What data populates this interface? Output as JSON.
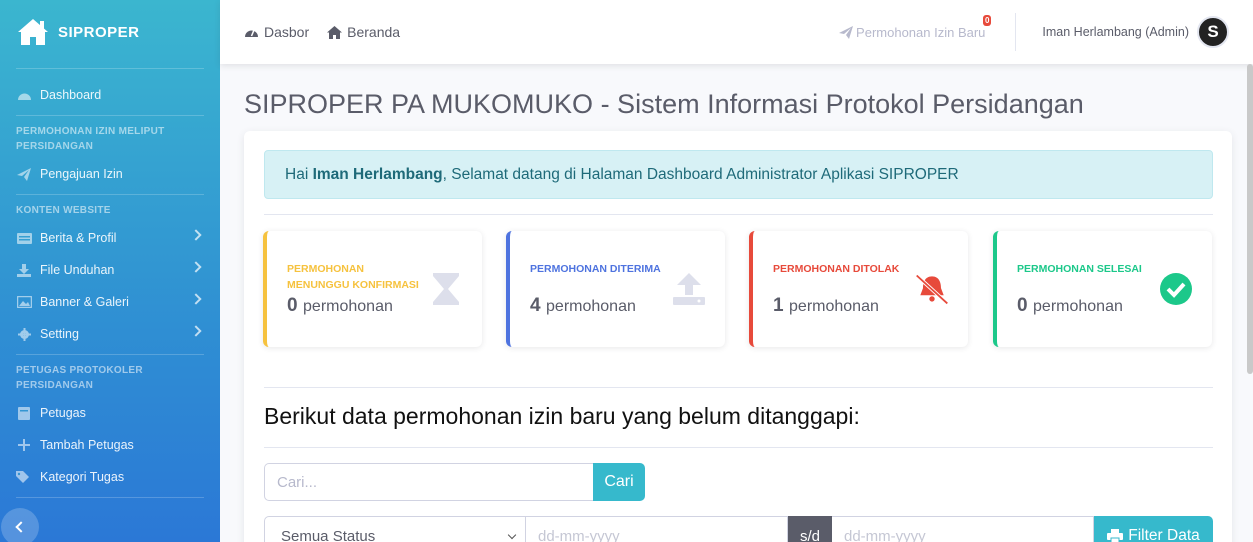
{
  "sidebar": {
    "brand": "SIPROPER",
    "items": [
      {
        "label": "Dashboard"
      },
      {
        "heading": "PERMOHONAN IZIN MELIPUT PERSIDANGAN"
      },
      {
        "label": "Pengajuan Izin"
      },
      {
        "heading": "KONTEN WEBSITE"
      },
      {
        "label": "Berita & Profil"
      },
      {
        "label": "File Unduhan"
      },
      {
        "label": "Banner & Galeri"
      },
      {
        "label": "Setting"
      },
      {
        "heading": "PETUGAS PROTOKOLER PERSIDANGAN"
      },
      {
        "label": "Petugas"
      },
      {
        "label": "Tambah Petugas"
      },
      {
        "label": "Kategori Tugas"
      }
    ]
  },
  "topbar": {
    "dasbor": "Dasbor",
    "beranda": "Beranda",
    "new_request": "Permohonan Izin Baru",
    "new_request_count": "0",
    "user": "Iman Herlambang (Admin)",
    "avatar_letter": "S"
  },
  "main": {
    "title": "SIPROPER PA MUKOMUKO - Sistem Informasi Protokol Persidangan",
    "alert": {
      "prefix": "Hai ",
      "name": "Iman Herlambang",
      "suffix": ", Selamat datang di Halaman Dashboard Administrator Aplikasi SIPROPER"
    },
    "stats": [
      {
        "label": "PERMOHONAN MENUNGGU KONFIRMASI",
        "count": "0",
        "unit": "permohonan",
        "color": "#f6c23e"
      },
      {
        "label": "PERMOHONAN DITERIMA",
        "count": "4",
        "unit": "permohonan",
        "color": "#4e73df"
      },
      {
        "label": "PERMOHONAN DITOLAK",
        "count": "1",
        "unit": "permohonan",
        "color": "#e74a3b"
      },
      {
        "label": "PERMOHONAN SELESAI",
        "count": "0",
        "unit": "permohonan",
        "color": "#1cc88a"
      }
    ],
    "section_title": "Berikut data permohonan izin baru yang belum ditanggapi:",
    "search": {
      "placeholder": "Cari...",
      "button": "Cari"
    },
    "filter": {
      "status": "Semua Status",
      "date_from": "dd-mm-yyyy",
      "sd": "s/d",
      "date_to": "dd-mm-yyyy",
      "button": "Filter Data"
    }
  }
}
